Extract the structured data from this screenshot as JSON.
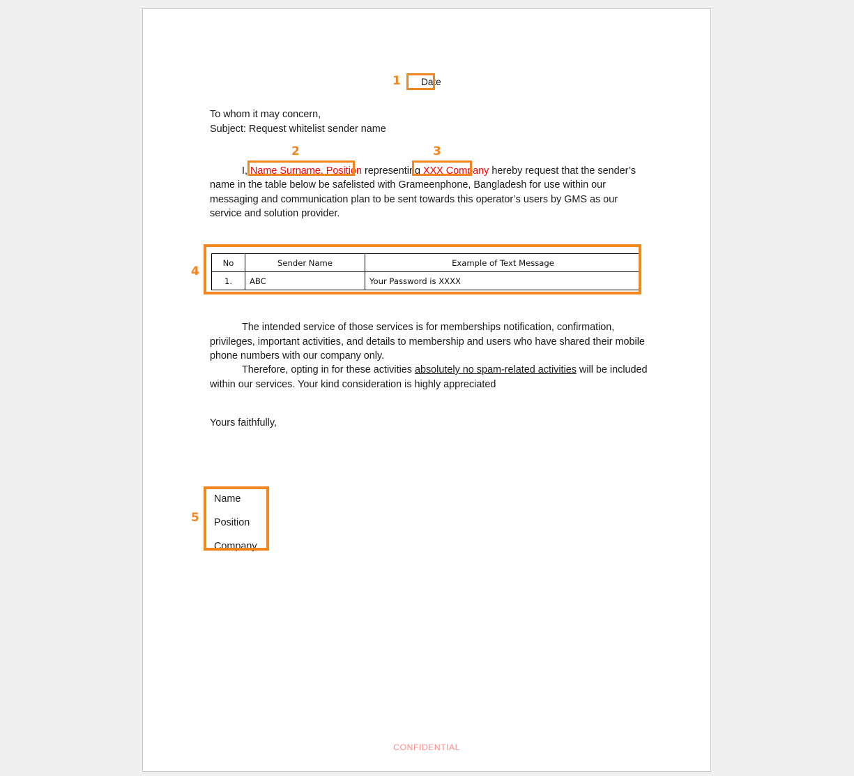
{
  "document": {
    "date_placeholder": "Date",
    "salutation": {
      "greeting": "To whom it may concern,",
      "subject": "Subject: Request whitelist sender name"
    },
    "paragraph_1": {
      "lead": "I, ",
      "highlight_name": "Name Surname, Position",
      "middle": " representing ",
      "highlight_company": "XXX Company",
      "tail": " hereby request that the sender’s name in the table below be safelisted with Grameenphone, Bangladesh for use within our messaging and communication plan to be sent towards this operator’s users by GMS as our service and solution provider."
    },
    "table": {
      "headers": [
        "No",
        "Sender Name",
        "Example of Text Message"
      ],
      "rows": [
        [
          "1.",
          "ABC",
          "Your Password is XXXX"
        ]
      ]
    },
    "paragraph_2": "The intended service of those services is for memberships notification, confirmation, privileges, important activities, and details to membership and users who have shared their mobile phone numbers with our company only.",
    "paragraph_3": {
      "before": "Therefore, opting in for these activities ",
      "underlined": "absolutely no spam-related activities",
      "after": " will be included within our services. Your kind consideration is highly appreciated"
    },
    "closing": "Yours faithfully,",
    "signature": {
      "name": "Name",
      "position": "Position",
      "company": "Company"
    },
    "footer": "CONFIDENTIAL"
  },
  "annotations": {
    "color": "#F3861E",
    "items": [
      {
        "number": "1",
        "target": "date-field"
      },
      {
        "number": "2",
        "target": "sender-name-position"
      },
      {
        "number": "3",
        "target": "company-name"
      },
      {
        "number": "4",
        "target": "sender-table"
      },
      {
        "number": "5",
        "target": "signature-block"
      }
    ]
  },
  "colors": {
    "highlight_text": "#FF0000",
    "annotation_orange": "#F3861E",
    "footer_text": "#FB8E8E",
    "page_background": "#FFFFFF",
    "canvas_background": "#F0F0F0"
  }
}
